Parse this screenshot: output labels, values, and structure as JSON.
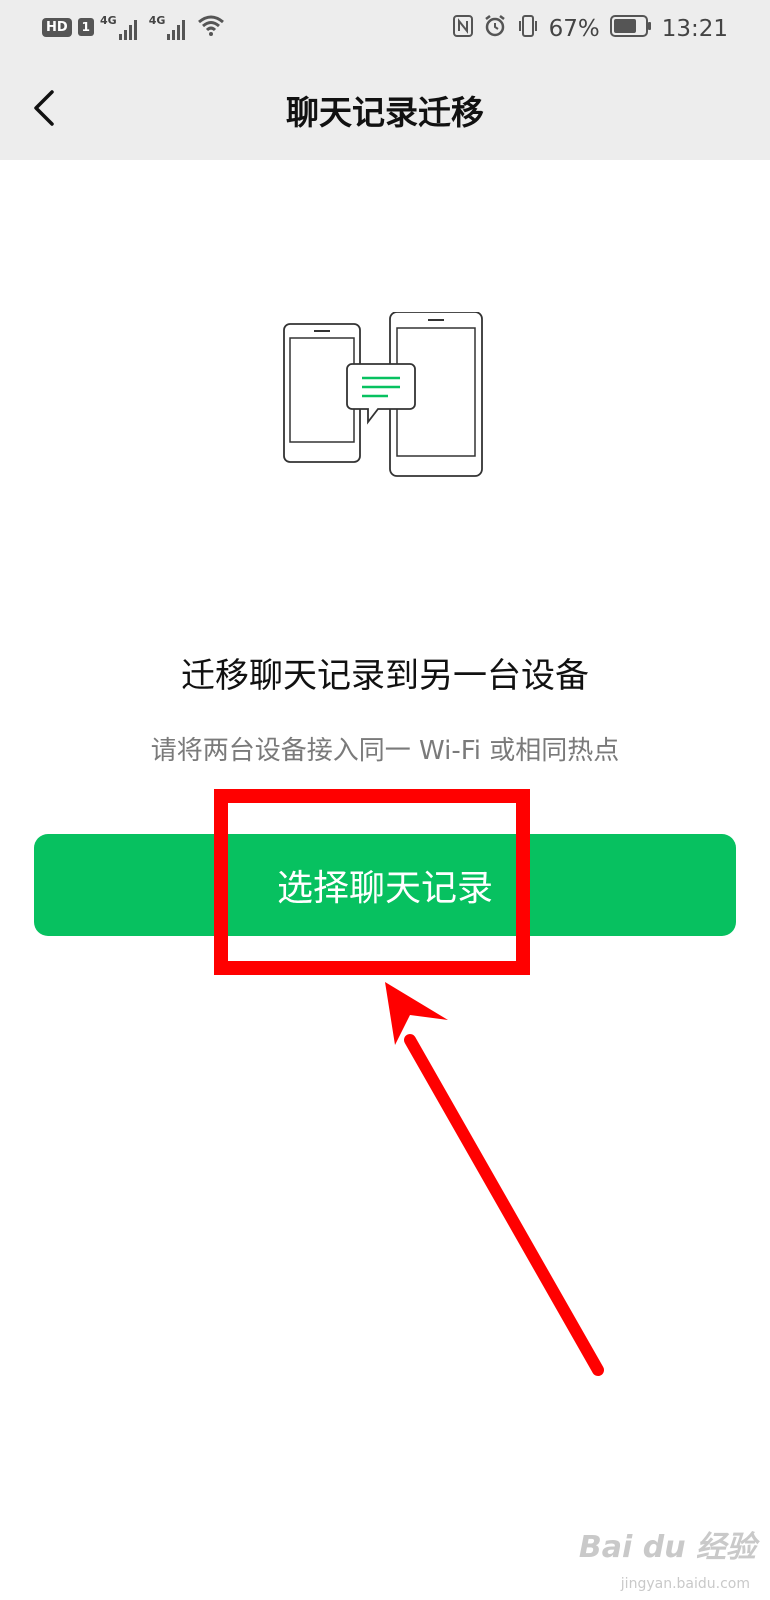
{
  "status_bar": {
    "hd_badge": "HD",
    "sim_badge": "1",
    "net1": "4G",
    "net2": "4G",
    "battery_percent": "67%",
    "time": "13:21"
  },
  "nav": {
    "title": "聊天记录迁移"
  },
  "main": {
    "headline": "迁移聊天记录到另一台设备",
    "subtext": "请将两台设备接入同一 Wi-Fi 或相同热点",
    "button_label": "选择聊天记录"
  },
  "watermark": {
    "brand": "Bai du 经验",
    "url": "jingyan.baidu.com"
  },
  "colors": {
    "accent": "#07c160",
    "annotation": "#ff0000",
    "bar_bg": "#ededed"
  }
}
